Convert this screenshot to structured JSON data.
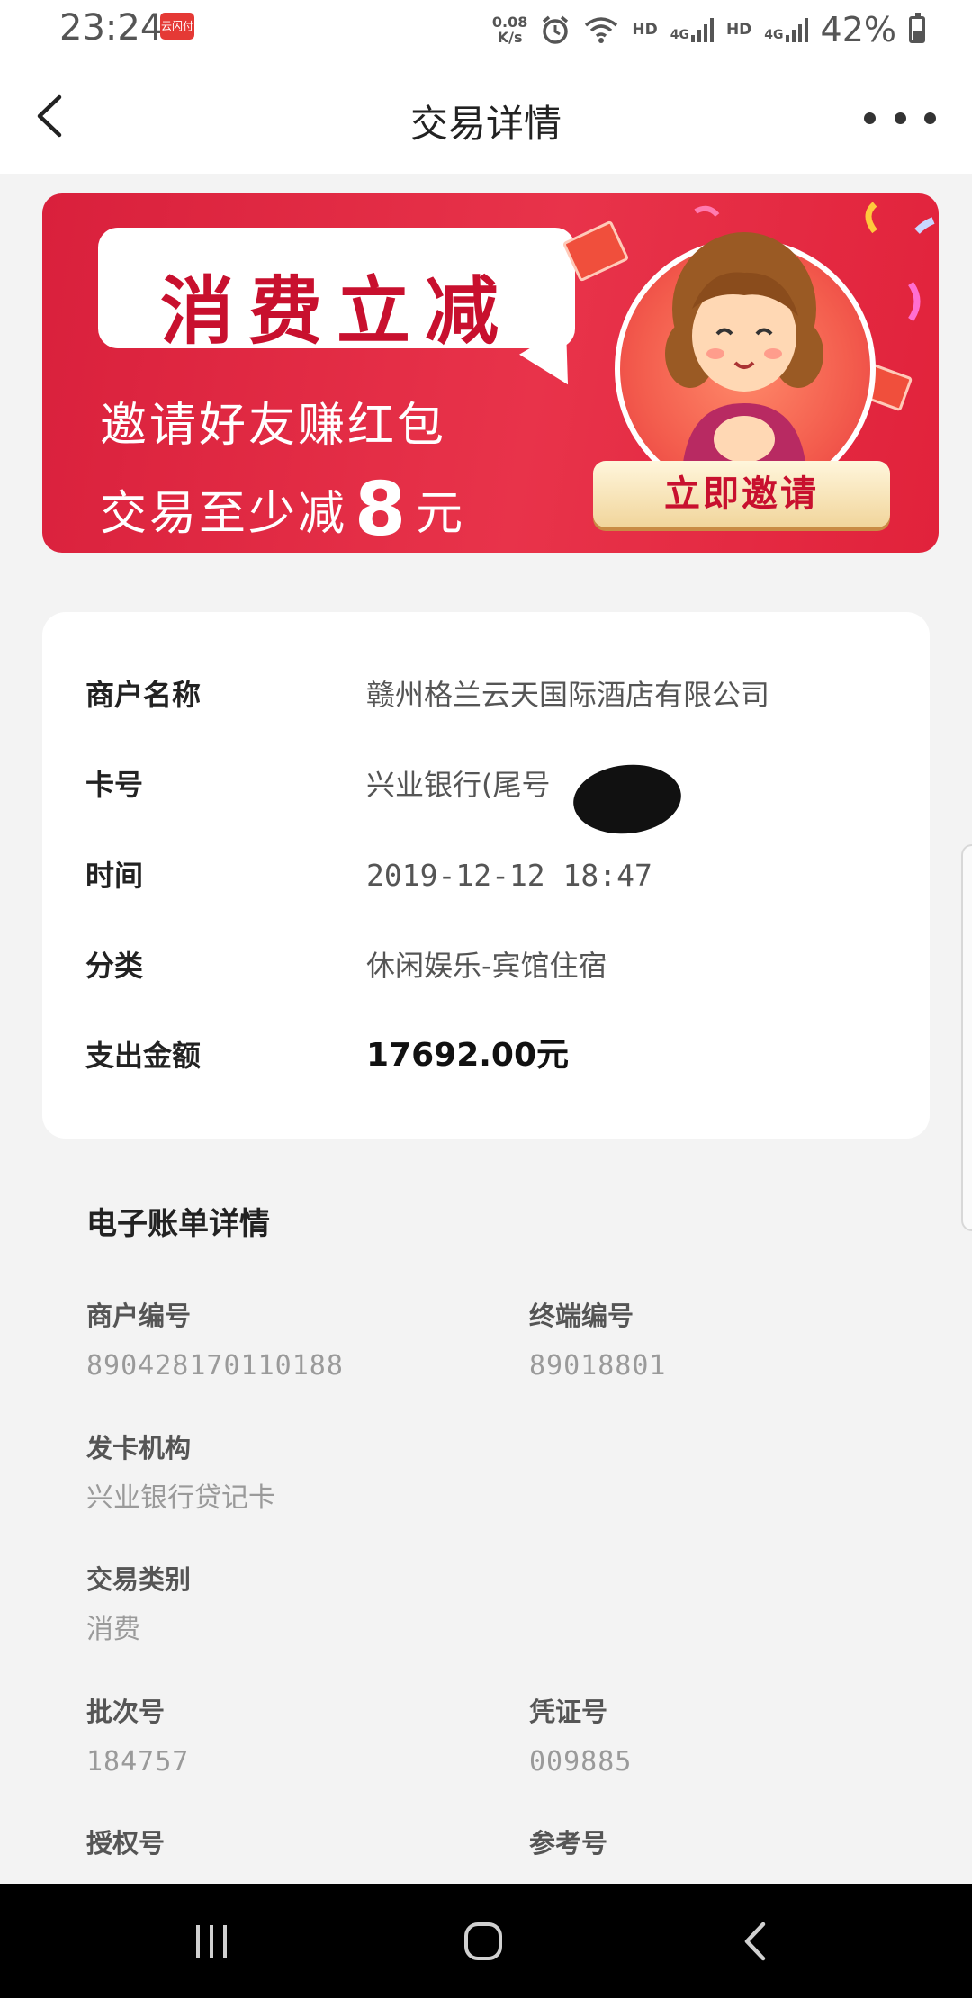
{
  "status_bar": {
    "time": "23:24",
    "app_badge": "云闪付",
    "net_speed_value": "0.08",
    "net_speed_unit": "K/s",
    "hd1": "HD",
    "net1": "4G",
    "hd2": "HD",
    "net2": "4G",
    "battery": "42%"
  },
  "header": {
    "title": "交易详情"
  },
  "banner": {
    "headline": "消费立减",
    "line1": "邀请好友赚红包",
    "line2_prefix": "交易至少减",
    "line2_number": "8",
    "line2_suffix": "元",
    "button": "立即邀请",
    "colors": {
      "background": "#e1223b",
      "headline": "#c8102e"
    }
  },
  "info": {
    "merchant_label": "商户名称",
    "merchant_value": "赣州格兰云天国际酒店有限公司",
    "card_label": "卡号",
    "card_value": "兴业银行(尾号",
    "time_label": "时间",
    "time_value": "2019-12-12 18:47",
    "category_label": "分类",
    "category_value": "休闲娱乐-宾馆住宿",
    "amount_label": "支出金额",
    "amount_value": "17692.00元"
  },
  "bill": {
    "title": "电子账单详情",
    "merchant_no_label": "商户编号",
    "merchant_no_value": "890428170110188",
    "terminal_no_label": "终端编号",
    "terminal_no_value": "89018801",
    "issuer_label": "发卡机构",
    "issuer_value": "兴业银行贷记卡",
    "txn_type_label": "交易类别",
    "txn_type_value": "消费",
    "batch_label": "批次号",
    "batch_value": "184757",
    "voucher_label": "凭证号",
    "voucher_value": "009885",
    "auth_label": "授权号",
    "ref_label": "参考号"
  },
  "nav": {
    "recents_icon": "recent-apps-icon",
    "home_icon": "home-icon",
    "back_icon": "back-icon"
  }
}
